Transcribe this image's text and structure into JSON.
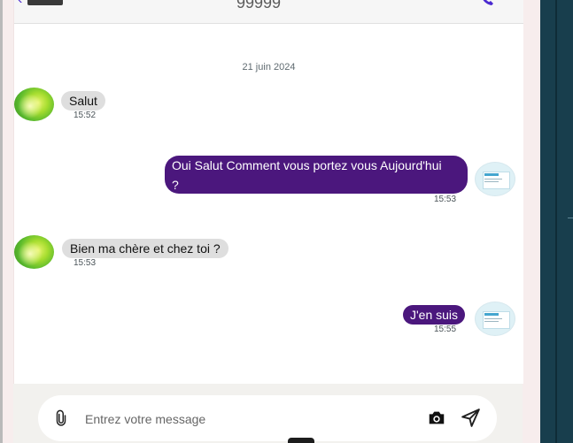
{
  "header": {
    "title": "99999"
  },
  "chat": {
    "date_label": "21 juin 2024",
    "messages": [
      {
        "side": "incoming",
        "text": "Salut",
        "time": "15:52"
      },
      {
        "side": "outgoing",
        "text_line_1": "Oui Salut Comment vous portez vous Aujourd'hui",
        "text_line_2": "?",
        "time": "15:53"
      },
      {
        "side": "incoming",
        "text": "Bien ma chère et chez toi ?",
        "time": "15:53"
      },
      {
        "side": "outgoing",
        "text": "J'en suis",
        "time": "15:55"
      }
    ]
  },
  "composer": {
    "placeholder": "Entrez votre message"
  },
  "icons": {
    "attach": "paperclip-icon",
    "camera": "camera-icon",
    "send": "send-icon",
    "back": "back-arrow-icon",
    "call": "phone-icon"
  },
  "colors": {
    "outgoing_bubble": "#4b177d",
    "incoming_bubble": "#dedede",
    "accent": "#4b2ad0"
  }
}
